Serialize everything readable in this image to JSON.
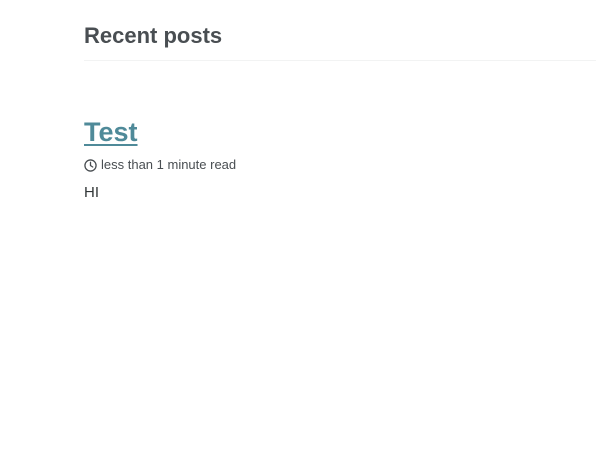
{
  "section": {
    "title": "Recent posts"
  },
  "posts": [
    {
      "title": "Test",
      "read_time": "less than 1 minute read",
      "excerpt": "HI",
      "meta_icon": "clock-icon"
    }
  ],
  "colors": {
    "text": "#494e52",
    "link": "#4f8a99",
    "divider": "#f2f3f3"
  }
}
